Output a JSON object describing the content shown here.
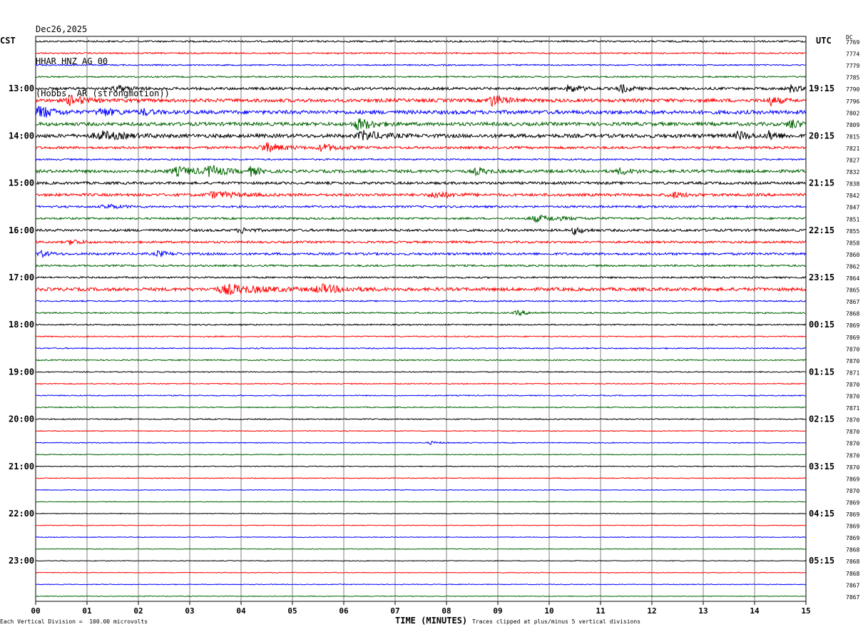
{
  "header": {
    "date": "Dec26,2025",
    "station": "HHAR HNZ AG 00",
    "location": "(Hobbs, AR (strongmotion))"
  },
  "left_label": "CST",
  "right_label": "UTC",
  "dc_label": "DC",
  "footer": {
    "scale_note": "Each Vertical Division =  100.00 microvolts",
    "clip_note": "Traces clipped at plus/minus 5 vertical divisions"
  },
  "chart_data": {
    "type": "line",
    "title": "",
    "xlabel": "TIME (MINUTES)",
    "ylabel": "",
    "xlim": [
      0,
      15
    ],
    "x_ticks": [
      "00",
      "01",
      "02",
      "03",
      "04",
      "05",
      "06",
      "07",
      "08",
      "09",
      "10",
      "11",
      "12",
      "13",
      "14",
      "15"
    ],
    "trace_colors": [
      "#000000",
      "#ff0000",
      "#0000ff",
      "#006400"
    ],
    "trace_minutes": 15,
    "trace_count": 48,
    "cst_time_labels": [
      "13:00",
      "14:00",
      "15:00",
      "16:00",
      "17:00",
      "18:00",
      "19:00",
      "20:00",
      "21:00",
      "22:00",
      "23:00"
    ],
    "utc_time_labels": [
      "19:15",
      "20:15",
      "21:15",
      "22:15",
      "23:15",
      "00:15",
      "01:15",
      "02:15",
      "03:15",
      "04:15",
      "05:15"
    ],
    "hour_label_first_trace": 4,
    "dc_offsets": [
      "7769",
      "7774",
      "7779",
      "7785",
      "7790",
      "7796",
      "7802",
      "7809",
      "7815",
      "7821",
      "7827",
      "7832",
      "7838",
      "7842",
      "7847",
      "7851",
      "7855",
      "7858",
      "7860",
      "7862",
      "7864",
      "7865",
      "7867",
      "7868",
      "7869",
      "7869",
      "7870",
      "7870",
      "7871",
      "7870",
      "7870",
      "7871",
      "7870",
      "7870",
      "7870",
      "7870",
      "7870",
      "7869",
      "7870",
      "7869",
      "7869",
      "7869",
      "7869",
      "7868",
      "7868",
      "7868",
      "7867",
      "7867"
    ],
    "trace_noise": [
      1.2,
      1.0,
      0.9,
      1.0,
      1.8,
      2.4,
      2.6,
      2.4,
      2.6,
      1.7,
      1.1,
      2.1,
      1.8,
      1.9,
      1.4,
      1.3,
      1.7,
      1.5,
      1.6,
      1.3,
      1.2,
      2.3,
      0.9,
      1.0,
      0.9,
      0.8,
      0.8,
      0.8,
      0.7,
      0.7,
      0.7,
      0.7,
      0.8,
      0.6,
      0.6,
      0.6,
      0.6,
      0.6,
      0.5,
      0.5,
      0.5,
      0.5,
      0.5,
      0.5,
      0.5,
      0.5,
      0.5,
      0.5
    ],
    "events": [
      {
        "trace": 4,
        "minute": 1.6,
        "amp": 4,
        "dur": 0.5
      },
      {
        "trace": 4,
        "minute": 10.4,
        "amp": 5,
        "dur": 0.4
      },
      {
        "trace": 4,
        "minute": 11.4,
        "amp": 6,
        "dur": 0.3
      },
      {
        "trace": 4,
        "minute": 14.7,
        "amp": 5,
        "dur": 0.3
      },
      {
        "trace": 5,
        "minute": 0.7,
        "amp": 7,
        "dur": 0.4
      },
      {
        "trace": 5,
        "minute": 8.9,
        "amp": 8,
        "dur": 0.4
      },
      {
        "trace": 5,
        "minute": 14.3,
        "amp": 6,
        "dur": 0.3
      },
      {
        "trace": 6,
        "minute": 0.1,
        "amp": 9,
        "dur": 0.4
      },
      {
        "trace": 6,
        "minute": 1.3,
        "amp": 5,
        "dur": 0.5
      },
      {
        "trace": 6,
        "minute": 2.1,
        "amp": 4,
        "dur": 0.3
      },
      {
        "trace": 7,
        "minute": 6.3,
        "amp": 8,
        "dur": 0.5
      },
      {
        "trace": 7,
        "minute": 14.7,
        "amp": 7,
        "dur": 0.3
      },
      {
        "trace": 8,
        "minute": 1.3,
        "amp": 5,
        "dur": 0.8
      },
      {
        "trace": 8,
        "minute": 6.4,
        "amp": 6,
        "dur": 0.6
      },
      {
        "trace": 8,
        "minute": 13.7,
        "amp": 6,
        "dur": 0.3
      },
      {
        "trace": 8,
        "minute": 14.3,
        "amp": 6,
        "dur": 0.3
      },
      {
        "trace": 9,
        "minute": 4.5,
        "amp": 6,
        "dur": 0.6
      },
      {
        "trace": 9,
        "minute": 5.6,
        "amp": 5,
        "dur": 0.5
      },
      {
        "trace": 11,
        "minute": 2.8,
        "amp": 5,
        "dur": 0.8
      },
      {
        "trace": 11,
        "minute": 3.4,
        "amp": 7,
        "dur": 0.4
      },
      {
        "trace": 11,
        "minute": 4.2,
        "amp": 6,
        "dur": 0.3
      },
      {
        "trace": 11,
        "minute": 8.6,
        "amp": 5,
        "dur": 0.3
      },
      {
        "trace": 11,
        "minute": 11.4,
        "amp": 4,
        "dur": 0.4
      },
      {
        "trace": 13,
        "minute": 3.5,
        "amp": 4,
        "dur": 0.8
      },
      {
        "trace": 13,
        "minute": 7.8,
        "amp": 4,
        "dur": 0.6
      },
      {
        "trace": 13,
        "minute": 12.4,
        "amp": 4,
        "dur": 0.4
      },
      {
        "trace": 14,
        "minute": 1.4,
        "amp": 3,
        "dur": 0.5
      },
      {
        "trace": 15,
        "minute": 9.8,
        "amp": 4,
        "dur": 0.9
      },
      {
        "trace": 16,
        "minute": 4.0,
        "amp": 4,
        "dur": 0.3
      },
      {
        "trace": 16,
        "minute": 10.5,
        "amp": 5,
        "dur": 0.3
      },
      {
        "trace": 17,
        "minute": 0.7,
        "amp": 4,
        "dur": 0.3
      },
      {
        "trace": 18,
        "minute": 0.1,
        "amp": 4,
        "dur": 0.3
      },
      {
        "trace": 18,
        "minute": 2.4,
        "amp": 4,
        "dur": 0.3
      },
      {
        "trace": 21,
        "minute": 3.8,
        "amp": 6,
        "dur": 1.2
      },
      {
        "trace": 21,
        "minute": 5.6,
        "amp": 5,
        "dur": 0.8
      },
      {
        "trace": 23,
        "minute": 9.4,
        "amp": 3,
        "dur": 0.4
      },
      {
        "trace": 34,
        "minute": 7.7,
        "amp": 2,
        "dur": 0.3
      }
    ]
  }
}
